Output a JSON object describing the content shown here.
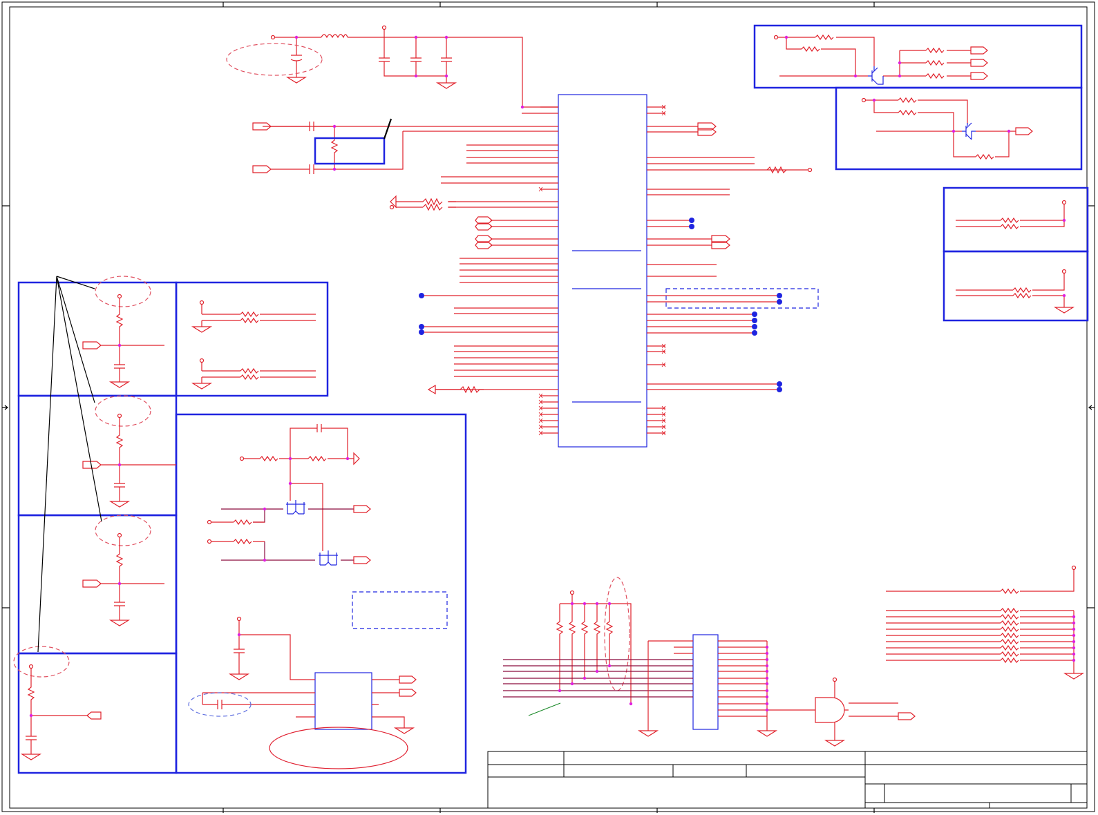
{
  "sheet": {
    "title_block": {
      "fields": []
    }
  },
  "colors": {
    "wire_red": "#e0202a",
    "wire_purple": "#8a0a3c",
    "box_blue": "#1f24e0",
    "junction_magenta": "#e020e0",
    "frame_black": "#000000",
    "annotation_green": "#1c8a2a"
  },
  "symbols": [
    "resistor",
    "capacitor",
    "inductor",
    "ground",
    "power-flag",
    "off-page-connector",
    "npn-transistor",
    "mosfet",
    "and-gate",
    "ic-package"
  ]
}
